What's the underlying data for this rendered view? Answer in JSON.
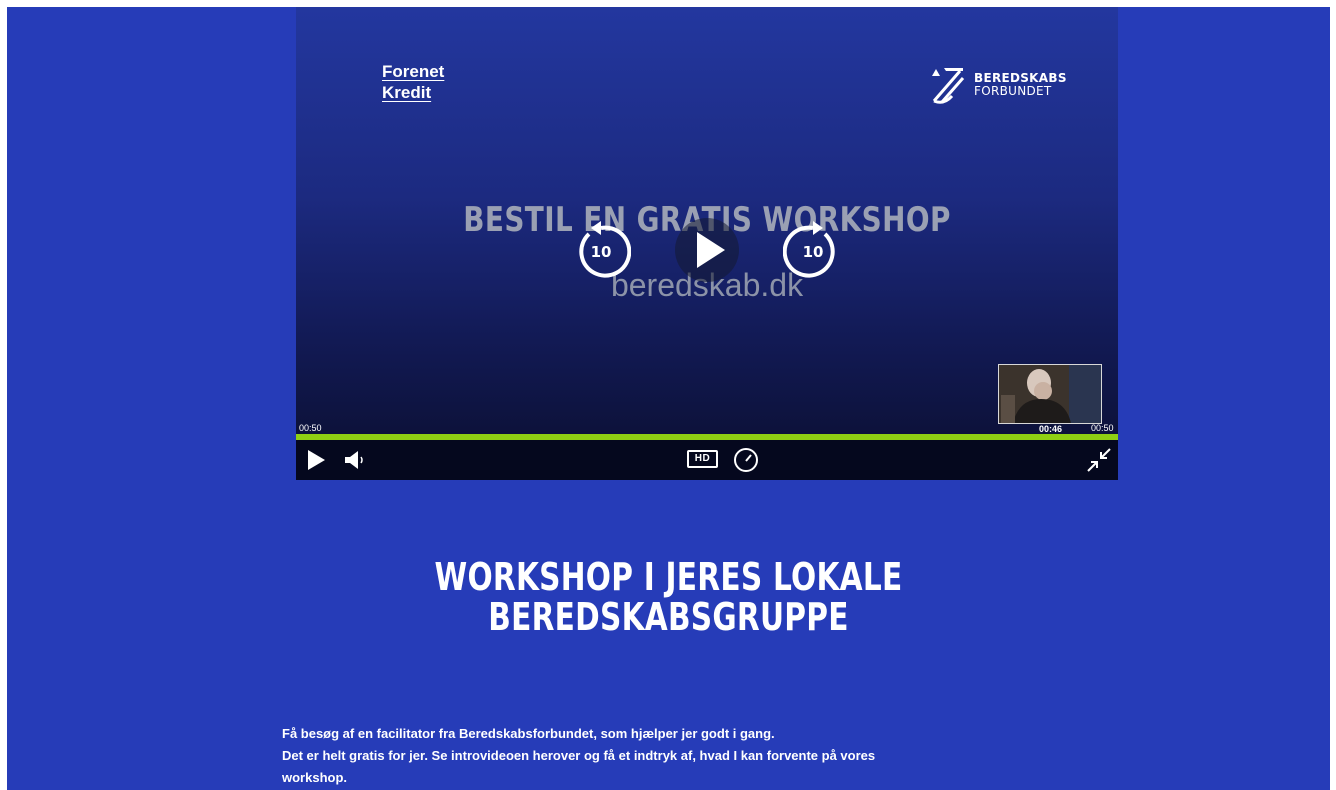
{
  "video": {
    "logo_left_line1": "Forenet",
    "logo_left_line2": "Kredit",
    "logo_right_line1": "BEREDSKABS",
    "logo_right_line2": "FORBUNDET",
    "headline": "BESTIL EN GRATIS WORKSHOP",
    "url": "beredskab.dk",
    "skip_back_seconds": "10",
    "skip_forward_seconds": "10",
    "current_time": "00:50",
    "hover_time": "00:46",
    "duration": "00:50",
    "progress": 1.0,
    "hd_label": "HD",
    "accent_color": "#8fcf13"
  },
  "section": {
    "title_line1": "WORKSHOP I JERES LOKALE",
    "title_line2": "BEREDSKABSGRUPPE"
  },
  "body": {
    "paragraph1": "Få besøg af en facilitator fra Beredskabsforbundet, som hjælper jer godt i gang.",
    "paragraph2": "Det er helt gratis for jer. Se introvideoen herover og få et indtryk af, hvad I kan forvente på vores workshop."
  }
}
